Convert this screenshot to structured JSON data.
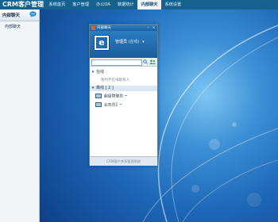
{
  "app": {
    "brand": "CRM客户管理"
  },
  "nav": {
    "items": [
      {
        "label": "系统首页"
      },
      {
        "label": "客户管理"
      },
      {
        "label": "办公OA"
      },
      {
        "label": "数据统计"
      },
      {
        "label": "内部聊天",
        "active": true
      },
      {
        "label": "系统设置"
      }
    ]
  },
  "sidebar": {
    "title": "内部聊天",
    "sub_item": "内部聊天"
  },
  "chat_window": {
    "title": "内部聊天",
    "user": {
      "name": "管理员",
      "status": "(在线)",
      "caret": "▾"
    },
    "search": {
      "placeholder": ""
    },
    "groups": [
      {
        "label": "在线",
        "arrow": "▾",
        "empty_text": "暂时不在线联系人"
      },
      {
        "label": "离线 [ 2 ]",
        "arrow": "▾"
      }
    ],
    "contacts": [
      {
        "name": "超级管理员 ~"
      },
      {
        "name": "业务员1 ~"
      }
    ],
    "footer": "CRM客户关系管理系统"
  },
  "colors": {
    "topbar": "#15628f",
    "accent": "#1b62a7",
    "desktop": "#1d68b8"
  }
}
